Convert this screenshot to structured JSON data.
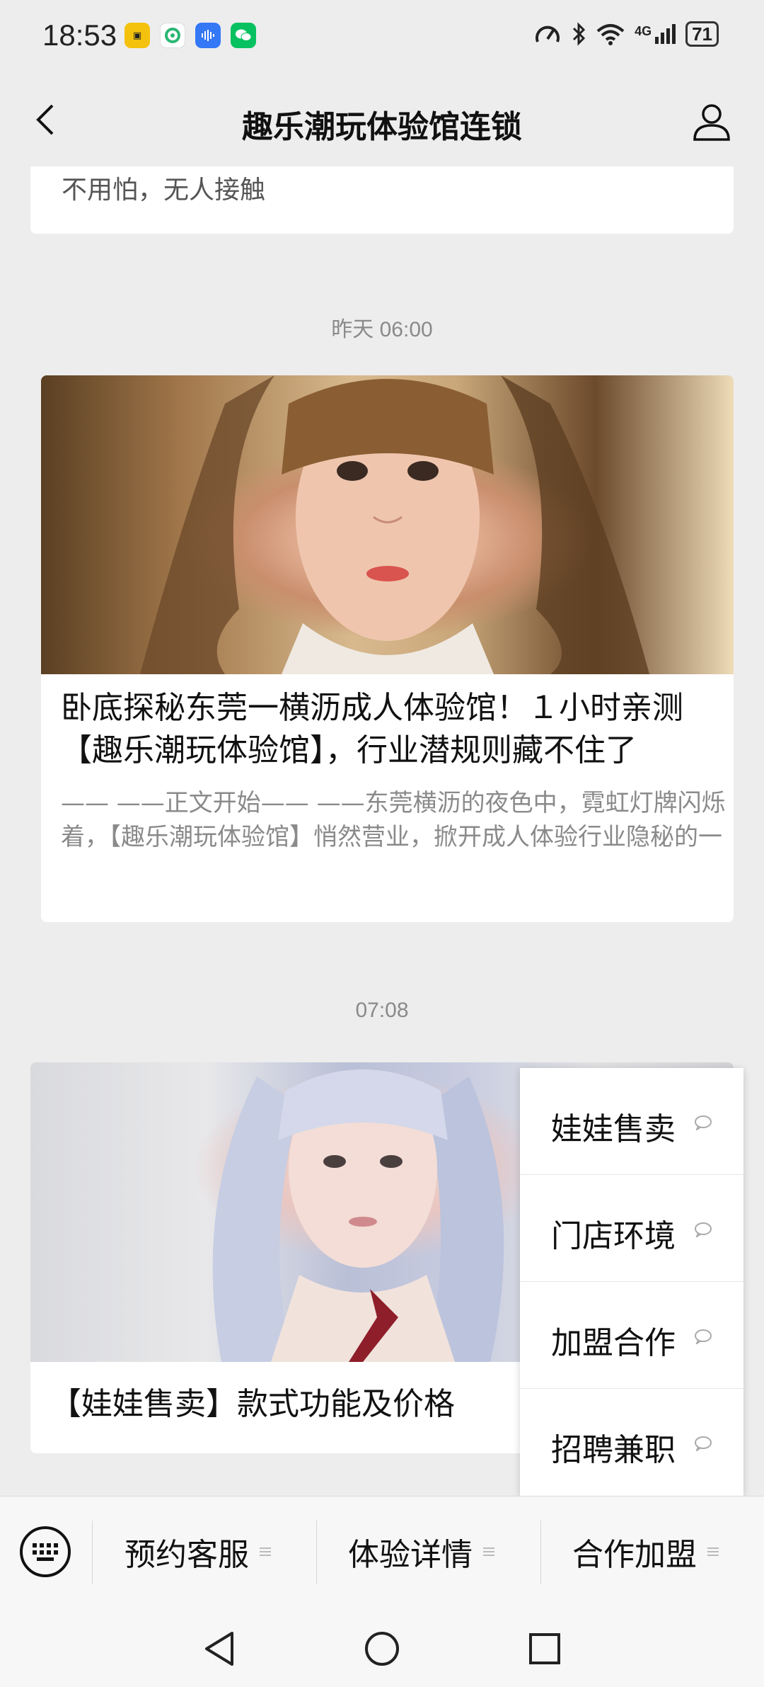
{
  "status_bar": {
    "time": "18:53",
    "battery": "71",
    "network": "4G",
    "icons": [
      "notification-app-icon",
      "app-icon-green",
      "voice-app-icon",
      "wechat-icon",
      "speed-icon",
      "bluetooth-icon",
      "wifi-icon",
      "signal-icon",
      "battery-icon"
    ]
  },
  "header": {
    "title": "趣乐潮玩体验馆连锁",
    "back_icon": "chevron-left-icon",
    "profile_icon": "person-icon"
  },
  "messages": {
    "prev_card_text": "不用怕，无人接触",
    "timestamp_1": "昨天 06:00",
    "article_1": {
      "title": "卧底探秘东莞一横沥成人体验馆！１小时亲测【趣乐潮玩体验馆】，行业潜规则藏不住了",
      "desc": "——  ——正文开始——  ——东莞横沥的夜色中，霓虹灯牌闪烁着，【趣乐潮玩体验馆】悄然营业，掀开成人体验行业隐秘的一"
    },
    "timestamp_2": "07:08",
    "article_2": {
      "title": "【娃娃售卖】款式功能及价格"
    }
  },
  "popup_menu": {
    "items": [
      {
        "label": "娃娃售卖"
      },
      {
        "label": "门店环境"
      },
      {
        "label": "加盟合作"
      },
      {
        "label": "招聘兼职"
      }
    ]
  },
  "bottom_menu": {
    "keyboard_icon": "keyboard-icon",
    "items": [
      {
        "label": "预约客服"
      },
      {
        "label": "体验详情"
      },
      {
        "label": "合作加盟"
      }
    ]
  },
  "system_nav": {
    "icons": [
      "back-triangle-icon",
      "home-circle-icon",
      "recents-square-icon"
    ]
  },
  "colors": {
    "background": "#ededed",
    "card": "#ffffff",
    "muted_text": "#8a8a8a",
    "wechat_green": "#07c160"
  }
}
